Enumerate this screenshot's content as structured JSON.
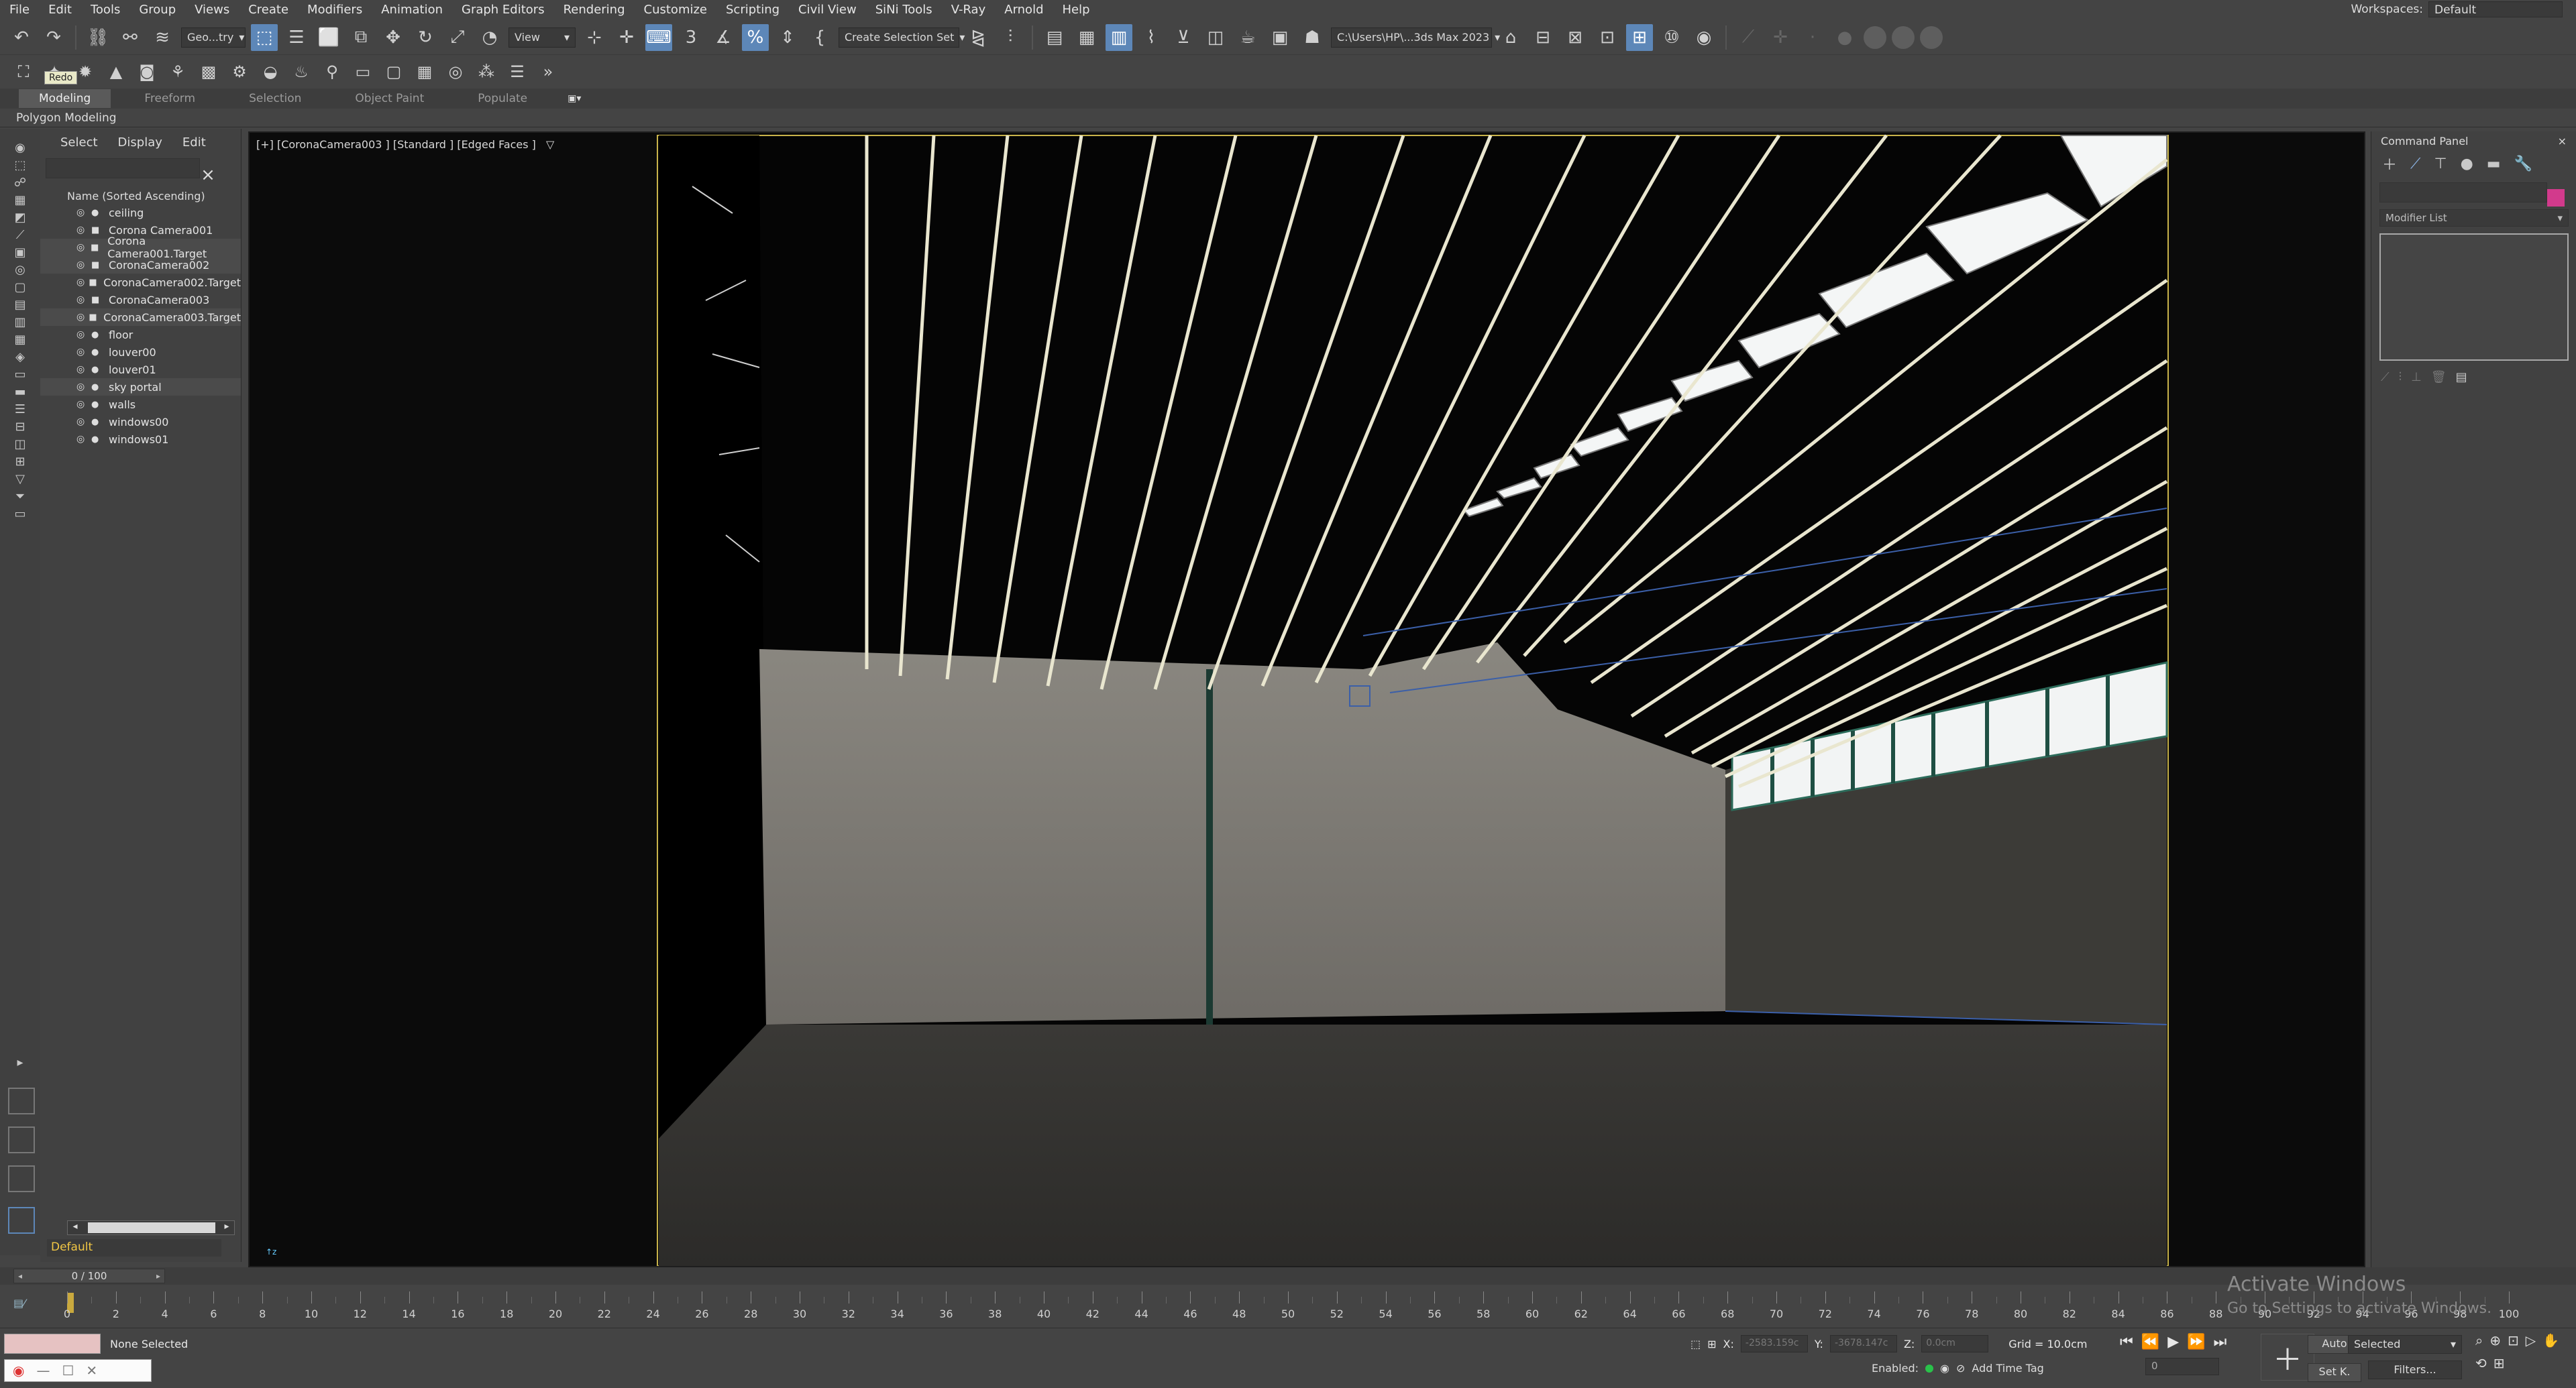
{
  "menubar": {
    "items": [
      "File",
      "Edit",
      "Tools",
      "Group",
      "Views",
      "Create",
      "Modifiers",
      "Animation",
      "Graph Editors",
      "Rendering",
      "Customize",
      "Scripting",
      "Civil View",
      "SiNi Tools",
      "V-Ray",
      "Arnold",
      "Help"
    ],
    "workspace_label": "Workspaces:",
    "workspace_value": "Default"
  },
  "toolbar": {
    "selection_filter": "Geo...try",
    "ref_coord": "View",
    "named_selection": "Create Selection Set",
    "project_path": "C:\\Users\\HP\\...3ds Max 2023",
    "tooltip": "Redo"
  },
  "ribbon": {
    "tabs": [
      "Modeling",
      "Freeform",
      "Selection",
      "Object Paint",
      "Populate"
    ],
    "active_tab": "Modeling",
    "sub_label": "Polygon Modeling"
  },
  "scene_explorer": {
    "tabs": [
      "Select",
      "Display",
      "Edit"
    ],
    "header": "Name (Sorted Ascending)",
    "items": [
      {
        "name": "ceiling",
        "type": "geo"
      },
      {
        "name": "Corona Camera001",
        "type": "cam"
      },
      {
        "name": "Corona Camera001.Target",
        "type": "cam"
      },
      {
        "name": "CoronaCamera002",
        "type": "cam"
      },
      {
        "name": "CoronaCamera002.Target",
        "type": "cam"
      },
      {
        "name": "CoronaCamera003",
        "type": "cam"
      },
      {
        "name": "CoronaCamera003.Target",
        "type": "cam"
      },
      {
        "name": "floor",
        "type": "geo"
      },
      {
        "name": "louver00",
        "type": "geo"
      },
      {
        "name": "louver01",
        "type": "geo"
      },
      {
        "name": "sky portal",
        "type": "geo"
      },
      {
        "name": "walls",
        "type": "geo"
      },
      {
        "name": "windows00",
        "type": "geo"
      },
      {
        "name": "windows01",
        "type": "geo"
      }
    ],
    "layer": "Default"
  },
  "viewport": {
    "label": "[+] [CoronaCamera003 ]  [Standard ]  [Edged Faces ]"
  },
  "command_panel": {
    "title": "Command Panel",
    "modifier_list": "Modifier List",
    "object_color": "#d23a8c"
  },
  "timeline": {
    "frame_display": "0 / 100",
    "frames": [
      "0",
      "2",
      "4",
      "6",
      "8",
      "10",
      "12",
      "14",
      "16",
      "18",
      "20",
      "22",
      "24",
      "26",
      "28",
      "30",
      "32",
      "34",
      "36",
      "38",
      "40",
      "42",
      "44",
      "46",
      "48",
      "50",
      "52",
      "54",
      "56",
      "58",
      "60",
      "62",
      "64",
      "66",
      "68",
      "70",
      "72",
      "74",
      "76",
      "78",
      "80",
      "82",
      "84",
      "86",
      "88",
      "90",
      "92",
      "94",
      "96",
      "98",
      "100"
    ]
  },
  "status": {
    "selection": "None Selected",
    "x_label": "X:",
    "x_value": "-2583.159c",
    "y_label": "Y:",
    "y_value": "-3678.147c",
    "z_label": "Z:",
    "z_value": "0.0cm",
    "grid": "Grid = 10.0cm",
    "enabled": "Enabled:",
    "add_time_tag": "Add Time Tag",
    "auto_key": "Auto",
    "set_key": "Set K.",
    "key_filter": "Selected",
    "filters": "Filters...",
    "current_frame": "0"
  },
  "watermark": {
    "title": "Activate Windows",
    "subtitle": "Go to Settings to activate Windows."
  },
  "colors": {
    "active_button": "#5d87b8",
    "layer_text": "#f2c744",
    "enabled_dot": "#29c24a"
  }
}
